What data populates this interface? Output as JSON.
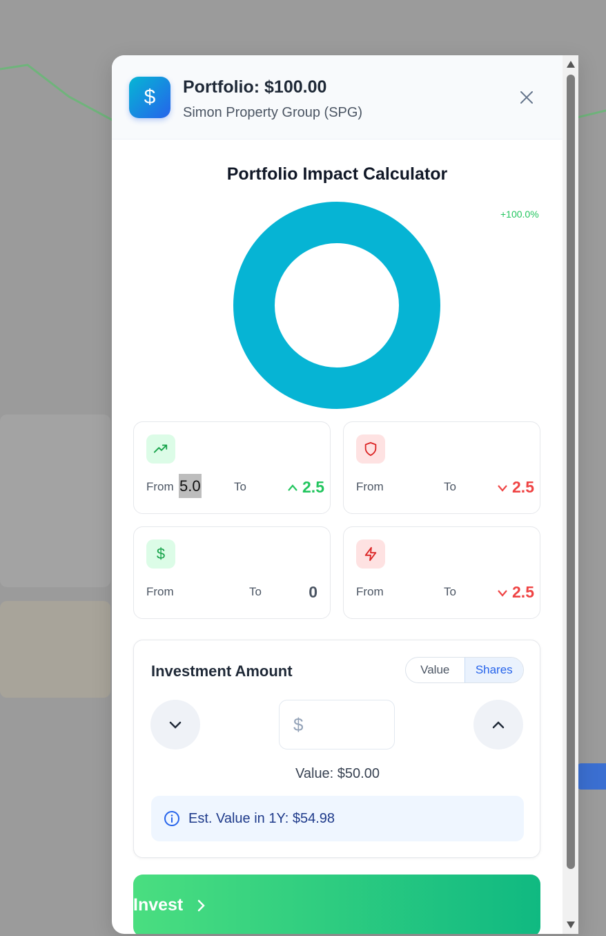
{
  "header": {
    "logo_symbol": "$",
    "title": "Portfolio: $100.00",
    "subtitle": "Simon Property Group (SPG)",
    "close_icon": "close-icon"
  },
  "calculator": {
    "title": "Portfolio Impact Calculator",
    "donut_label": "+100.0%",
    "donut_color": "#06b4d4",
    "donut_share": 1.0
  },
  "metrics": [
    {
      "icon": "trending-up-icon",
      "from_label": "From",
      "from_value": "5.0",
      "to_label": "To",
      "change": "2.5",
      "direction": "up",
      "color": "#22c55e"
    },
    {
      "icon": "shield-icon",
      "from_label": "From",
      "to_label": "To",
      "change": "2.5",
      "direction": "down",
      "color": "#ef4444"
    },
    {
      "icon": "dollar-icon",
      "from_label": "From",
      "to_label": "To",
      "change": "0",
      "direction": "none",
      "color": "#4b5563"
    },
    {
      "icon": "lightning-icon",
      "from_label": "From",
      "to_label": "To",
      "change": "2.5",
      "direction": "down",
      "color": "#ef4444"
    }
  ],
  "investment": {
    "title": "Investment Amount",
    "toggle_value": "Value",
    "toggle_shares": "Shares",
    "active_toggle": "Shares",
    "currency_symbol": "$",
    "input_value": "",
    "value_text": "Value: $50.00",
    "est_text": "Est. Value in 1Y: $54.98"
  },
  "invest_button": {
    "label": "Invest"
  },
  "colors": {
    "primary": "#2563eb",
    "success": "#22c55e",
    "danger": "#ef4444",
    "accent": "#06b4d4"
  }
}
